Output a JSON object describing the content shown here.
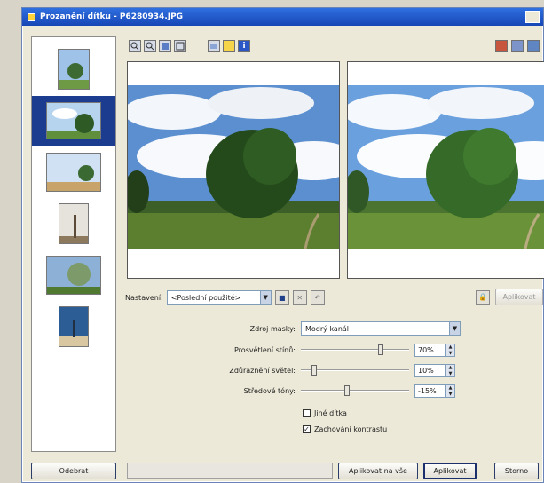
{
  "window": {
    "title": "Prozanění dítku - P6280934.JPG"
  },
  "toolbar_left": {
    "icons": [
      "zoom-in-icon",
      "zoom-out-icon",
      "fit-icon",
      "fullscreen-icon",
      "compare-icon",
      "folder-icon",
      "info-icon"
    ]
  },
  "toolbar_right": {
    "icons": [
      "split-view-icon",
      "before-after-icon",
      "single-view-icon"
    ]
  },
  "preset": {
    "label": "Nastavení:",
    "value": "<Poslední použité>"
  },
  "params": {
    "mode": {
      "label": "Zdroj masky:",
      "value": "Modrý kanál"
    },
    "brightness": {
      "label": "Prosvětlení stínů:",
      "value": "70%",
      "level": 0.75
    },
    "shadows": {
      "label": "Zdůraznění světel:",
      "value": "10%",
      "level": 0.1
    },
    "midtones": {
      "label": "Středové tóny:",
      "value": "-15%",
      "level": 0.42
    }
  },
  "checks": {
    "c1": {
      "label": "Jiné dítka",
      "checked": false
    },
    "c2": {
      "label": "Zachování kontrastu",
      "checked": true
    }
  },
  "buttons": {
    "apply_all": "Aplikovat na vše",
    "apply": "Aplikovat",
    "close": "Storno",
    "remove": "Odebrat",
    "apply_disabled": "Aplikovat"
  },
  "colors": {
    "title": "#1f5bd0",
    "selection": "#1c3d8f"
  }
}
